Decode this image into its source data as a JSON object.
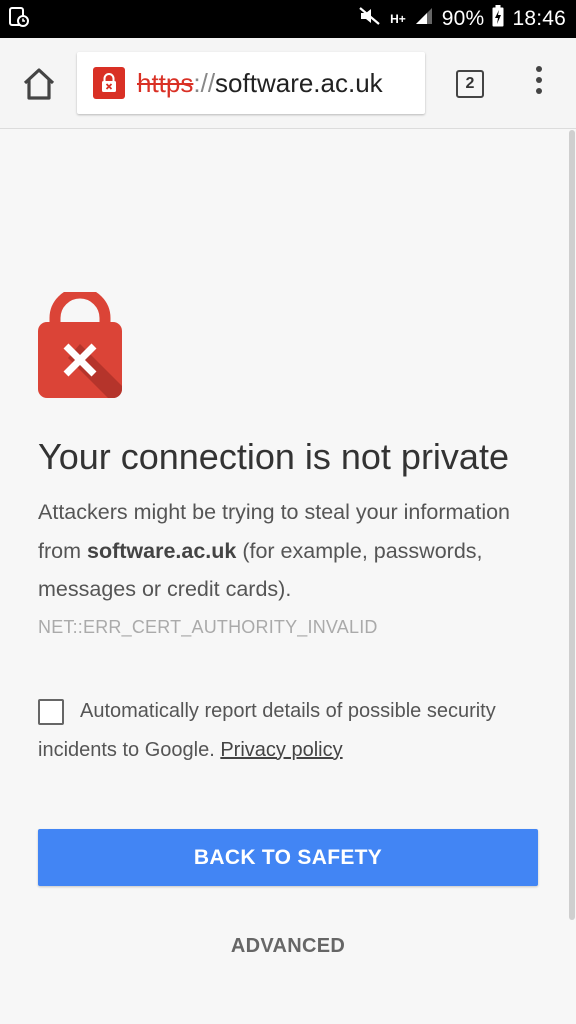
{
  "status_bar": {
    "battery": "90%",
    "time": "18:46",
    "network": "H+",
    "icons": [
      "screenshot-icon",
      "mute-icon",
      "data-arrows-icon",
      "signal-icon",
      "battery-charging-icon"
    ]
  },
  "toolbar": {
    "url_scheme": "https",
    "url_separator": "://",
    "url_host": "software.ac.uk",
    "tab_count": "2",
    "icons": [
      "home-icon",
      "lock-error-icon",
      "tab-switcher-icon",
      "overflow-menu-icon"
    ]
  },
  "interstitial": {
    "title": "Your connection is not private",
    "body_before": "Attackers might be trying to steal your information from ",
    "body_host": "software.ac.uk",
    "body_after": " (for example, passwords, messages or credit cards).",
    "error_code": "NET::ERR_CERT_AUTHORITY_INVALID",
    "report_text": "Automatically report details of possible security incidents to Google. ",
    "privacy_link": "Privacy policy",
    "report_checked": false,
    "back_button": "BACK TO SAFETY",
    "advanced_button": "ADVANCED"
  },
  "colors": {
    "error_red": "#d93025",
    "primary_blue": "#4285f4",
    "background": "#f7f7f7"
  }
}
